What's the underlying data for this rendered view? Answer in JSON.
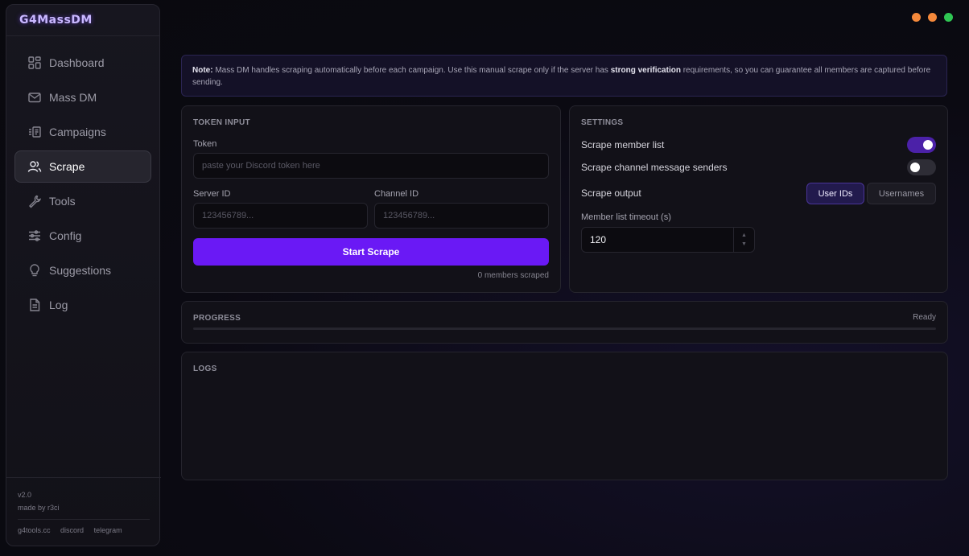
{
  "app": {
    "logo": "G4MassDM"
  },
  "sidebar": {
    "items": [
      {
        "label": "Dashboard",
        "icon": "dashboard-icon"
      },
      {
        "label": "Mass DM",
        "icon": "mail-icon"
      },
      {
        "label": "Campaigns",
        "icon": "campaigns-icon"
      },
      {
        "label": "Scrape",
        "icon": "users-icon",
        "active": true
      },
      {
        "label": "Tools",
        "icon": "wrench-icon"
      },
      {
        "label": "Config",
        "icon": "sliders-icon"
      },
      {
        "label": "Suggestions",
        "icon": "lightbulb-icon"
      },
      {
        "label": "Log",
        "icon": "document-icon"
      }
    ],
    "footer": {
      "version": "v2.0",
      "author": "made by r3ci",
      "links": [
        "g4tools.cc",
        "discord",
        "telegram"
      ]
    }
  },
  "window_dots": [
    "#f5893b",
    "#f5893b",
    "#2fc653"
  ],
  "note": {
    "prefix": "Note:",
    "text_1": " Mass DM handles scraping automatically before each campaign. Use this manual scrape only if the server has ",
    "emphasis": "strong verification",
    "text_2": " requirements, so you can guarantee all members are captured before sending."
  },
  "token_input": {
    "title": "TOKEN INPUT",
    "token_label": "Token",
    "token_placeholder": "paste your Discord token here",
    "server_label": "Server ID",
    "server_placeholder": "123456789...",
    "channel_label": "Channel ID",
    "channel_placeholder": "123456789...",
    "start_button": "Start Scrape",
    "scraped_status": "0 members scraped"
  },
  "settings": {
    "title": "SETTINGS",
    "scrape_member_list_label": "Scrape member list",
    "scrape_member_list_on": true,
    "scrape_senders_label": "Scrape channel message senders",
    "scrape_senders_on": false,
    "output_label": "Scrape output",
    "output_options": [
      "User IDs",
      "Usernames"
    ],
    "output_selected": "User IDs",
    "timeout_label": "Member list timeout (s)",
    "timeout_value": "120"
  },
  "progress": {
    "title": "PROGRESS",
    "status": "Ready",
    "fraction": 0
  },
  "logs": {
    "title": "LOGS"
  },
  "colors": {
    "accent": "#6a19f5",
    "toggle_on": "#4b21a8"
  }
}
